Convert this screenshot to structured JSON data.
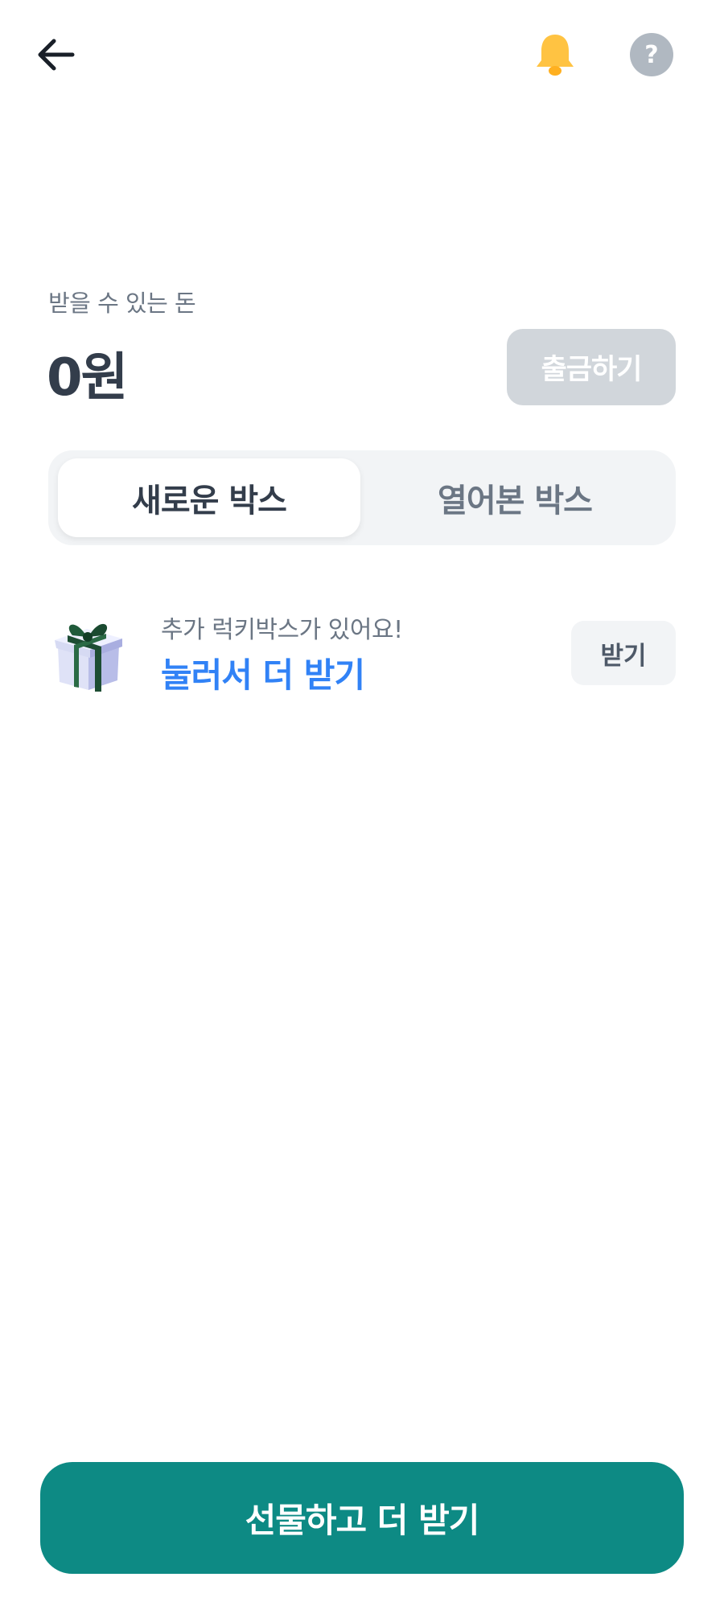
{
  "header": {
    "back_icon": "arrow-left-icon",
    "bell_icon": "bell-icon",
    "help_icon": "question-circle-icon",
    "help_glyph": "?"
  },
  "balance": {
    "label": "받을 수 있는 돈",
    "amount": "0원",
    "withdraw_label": "출금하기"
  },
  "tabs": [
    {
      "label": "새로운 박스",
      "active": true
    },
    {
      "label": "열어본 박스",
      "active": false
    }
  ],
  "lucky_box": {
    "icon": "gift-box-icon",
    "subtitle": "추가 럭키박스가 있어요!",
    "title": "눌러서 더 받기",
    "button_label": "받기"
  },
  "cta": {
    "label": "선물하고 더 받기"
  },
  "colors": {
    "accent_blue": "#3182f6",
    "cta_teal": "#0d8a84",
    "bell_yellow": "#ffc342",
    "disabled_gray": "#d1d6db",
    "help_gray": "#b0b8c1"
  }
}
